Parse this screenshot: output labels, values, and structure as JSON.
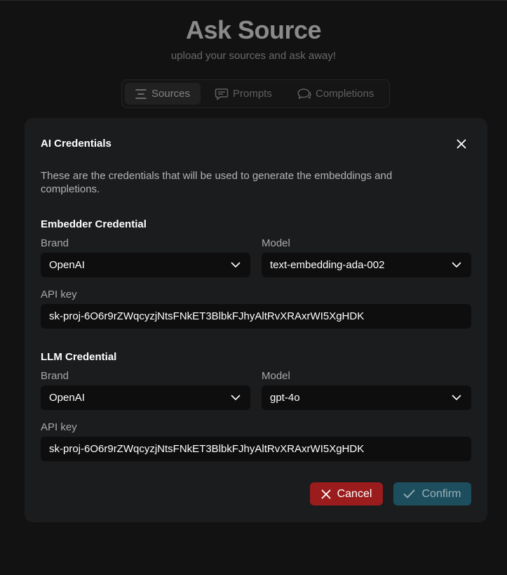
{
  "header": {
    "title": "Ask Source",
    "subtitle": "upload your sources and ask away!"
  },
  "tabs": [
    {
      "label": "Sources",
      "icon": "list-icon",
      "active": true
    },
    {
      "label": "Prompts",
      "icon": "message-square-icon",
      "active": false
    },
    {
      "label": "Completions",
      "icon": "chat-bubbles-icon",
      "active": false
    }
  ],
  "modal": {
    "title": "AI Credentials",
    "description": "These are the credentials that will be used to generate the embeddings and completions.",
    "embedder": {
      "title": "Embedder Credential",
      "brand_label": "Brand",
      "brand_value": "OpenAI",
      "model_label": "Model",
      "model_value": "text-embedding-ada-002",
      "api_key_label": "API key",
      "api_key_value": "sk-proj-6O6r9rZWqcyzjNtsFNkET3BlbkFJhyAltRvXRAxrWI5XgHDK"
    },
    "llm": {
      "title": "LLM Credential",
      "brand_label": "Brand",
      "brand_value": "OpenAI",
      "model_label": "Model",
      "model_value": "gpt-4o",
      "api_key_label": "API key",
      "api_key_value": "sk-proj-6O6r9rZWqcyzjNtsFNkET3BlbkFJhyAltRvXRAxrWI5XgHDK"
    },
    "cancel_label": "Cancel",
    "confirm_label": "Confirm"
  },
  "colors": {
    "background": "#121212",
    "modal": "#1b1c1e",
    "cancel": "#9b1c1c",
    "confirm": "#1d4e5e"
  }
}
